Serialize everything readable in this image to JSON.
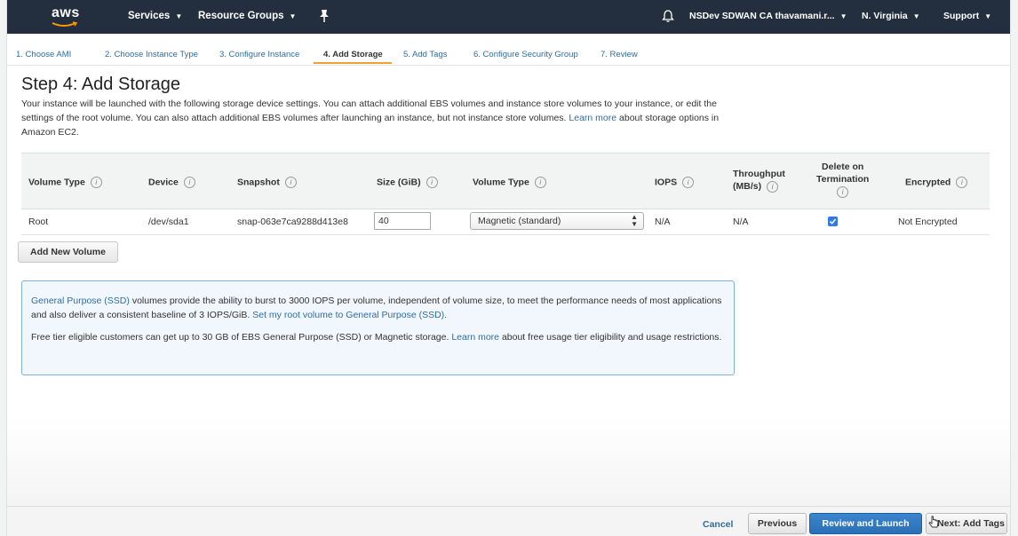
{
  "nav": {
    "logo": "aws",
    "services": "Services",
    "resource_groups": "Resource Groups",
    "account": "NSDev SDWAN CA thavamani.r...",
    "region": "N. Virginia",
    "support": "Support"
  },
  "tabs": [
    {
      "label": "1. Choose AMI"
    },
    {
      "label": "2. Choose Instance Type"
    },
    {
      "label": "3. Configure Instance"
    },
    {
      "label": "4. Add Storage",
      "active": true
    },
    {
      "label": "5. Add Tags"
    },
    {
      "label": "6. Configure Security Group"
    },
    {
      "label": "7. Review"
    }
  ],
  "page": {
    "title": "Step 4: Add Storage",
    "description": "Your instance will be launched with the following storage device settings. You can attach additional EBS volumes and instance store volumes to your instance, or edit the settings of the root volume. You can also attach additional EBS volumes after launching an instance, but not instance store volumes.",
    "learn_more": "Learn more",
    "description_tail": "about storage options in Amazon EC2."
  },
  "table": {
    "headers": {
      "volume_type": "Volume Type",
      "device": "Device",
      "snapshot": "Snapshot",
      "size": "Size (GiB)",
      "volume_type2": "Volume Type",
      "iops": "IOPS",
      "throughput_1": "Throughput",
      "throughput_2": "(MB/s)",
      "delete_1": "Delete on",
      "delete_2": "Termination",
      "encrypted": "Encrypted"
    },
    "row": {
      "volume_type": "Root",
      "device": "/dev/sda1",
      "snapshot": "snap-063e7ca9288d413e8",
      "size": "40",
      "volume_type_selected": "Magnetic (standard)",
      "iops": "N/A",
      "throughput": "N/A",
      "delete_on_termination": true,
      "encrypted": "Not Encrypted"
    }
  },
  "add_volume_label": "Add New Volume",
  "infobox": {
    "gp_link": "General Purpose (SSD)",
    "p1_text": "volumes provide the ability to burst to 3000 IOPS per volume, independent of volume size, to meet the performance needs of most applications and also deliver a consistent baseline of 3 IOPS/GiB.",
    "p1_link": "Set my root volume to General Purpose (SSD).",
    "p2_text": "Free tier eligible customers can get up to 30 GB of EBS General Purpose (SSD) or Magnetic storage.",
    "p2_link": "Learn more",
    "p2_tail": "about free usage tier eligibility and usage restrictions."
  },
  "footer": {
    "cancel": "Cancel",
    "previous": "Previous",
    "review_launch": "Review and Launch",
    "next": "Next: Add Tags"
  },
  "colors": {
    "navbar": "#232f3e",
    "link": "#2e6da4",
    "primary_button": "#2a6fb6",
    "active_tab_underline": "#f0a030",
    "infobox_border": "#7eb3dd"
  }
}
